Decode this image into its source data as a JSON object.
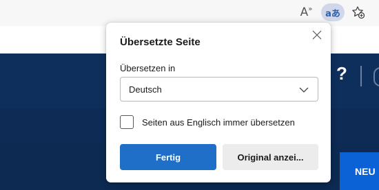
{
  "toolbar": {
    "read_aloud_glyph": "A",
    "read_aloud_wave": "»",
    "translate_glyph": "aあ",
    "favorites_icon": "star-add-icon"
  },
  "site": {
    "help_glyph": "?",
    "cta_label": "NEU"
  },
  "popup": {
    "title": "Übersetzte Seite",
    "translate_to_label": "Übersetzen in",
    "language_selected": "Deutsch",
    "always_translate_label": "Seiten aus Englisch immer übersetzen",
    "always_translate_checked": false,
    "done_label": "Fertig",
    "show_original_label": "Original anzei..."
  },
  "colors": {
    "accent": "#1f6fc8",
    "header_blue": "#0e2f5c",
    "cta_blue": "#0a62d6"
  }
}
